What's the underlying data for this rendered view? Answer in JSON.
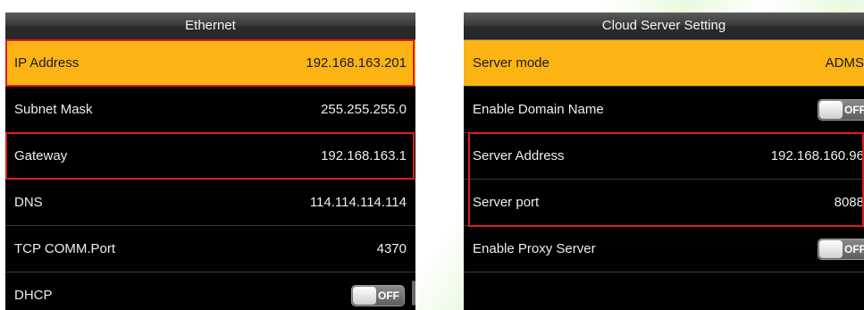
{
  "ethernet": {
    "title": "Ethernet",
    "rows": [
      {
        "label": "IP Address",
        "value": "192.168.163.201"
      },
      {
        "label": "Subnet Mask",
        "value": "255.255.255.0"
      },
      {
        "label": "Gateway",
        "value": "192.168.163.1"
      },
      {
        "label": "DNS",
        "value": "114.114.114.114"
      },
      {
        "label": "TCP COMM.Port",
        "value": "4370"
      },
      {
        "label": "DHCP",
        "toggle": "OFF"
      }
    ]
  },
  "cloud": {
    "title": "Cloud Server Setting",
    "rows": [
      {
        "label": "Server mode",
        "value": "ADMS"
      },
      {
        "label": "Enable Domain Name",
        "toggle": "OFF"
      },
      {
        "label": "Server Address",
        "value": "192.168.160.96"
      },
      {
        "label": "Server port",
        "value": "8088"
      },
      {
        "label": "Enable Proxy Server",
        "toggle": "OFF"
      }
    ]
  },
  "colors": {
    "selected_row": "#fbb413",
    "highlight_border": "#e11b1b",
    "panel_background": "#000000"
  }
}
